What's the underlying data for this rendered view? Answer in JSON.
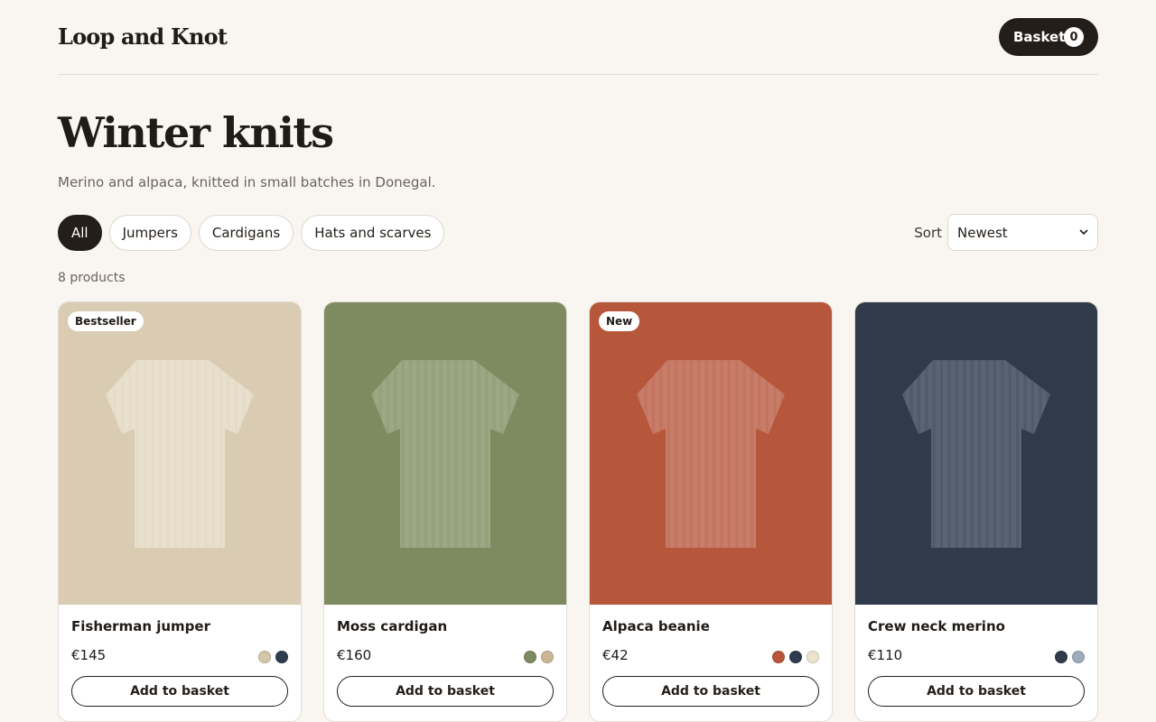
{
  "header": {
    "logo": "Loop and Knot",
    "basket_label": "Basket",
    "basket_count": "0"
  },
  "page": {
    "title": "Winter knits",
    "subtitle": "Merino and alpaca, knitted in small batches in Donegal.",
    "product_count": "8 products"
  },
  "filters": [
    {
      "label": "All",
      "active": true
    },
    {
      "label": "Jumpers",
      "active": false
    },
    {
      "label": "Cardigans",
      "active": false
    },
    {
      "label": "Hats and scarves",
      "active": false
    }
  ],
  "sort": {
    "label": "Sort",
    "selected": "Newest"
  },
  "add_label": "Add to basket",
  "products": [
    {
      "name": "Fisherman jumper",
      "price": "€145",
      "badge": "Bestseller",
      "bg": "#d9ccb3",
      "tint": "#ece4d4",
      "swatches": [
        "#d4c6ab",
        "#2f3b4e"
      ]
    },
    {
      "name": "Moss cardigan",
      "price": "€160",
      "badge": "",
      "bg": "#7e8b60",
      "tint": "#a4ae8c",
      "swatches": [
        "#7e8b60",
        "#cbb796"
      ]
    },
    {
      "name": "Alpaca beanie",
      "price": "€42",
      "badge": "New",
      "bg": "#b6563b",
      "tint": "#cc8775",
      "swatches": [
        "#b6563b",
        "#2f3b4e",
        "#ece2cd"
      ]
    },
    {
      "name": "Crew neck merino",
      "price": "€110",
      "badge": "",
      "bg": "#2f3a4b",
      "tint": "#656e7d",
      "swatches": [
        "#2f3a4b",
        "#9dabbb"
      ]
    }
  ]
}
